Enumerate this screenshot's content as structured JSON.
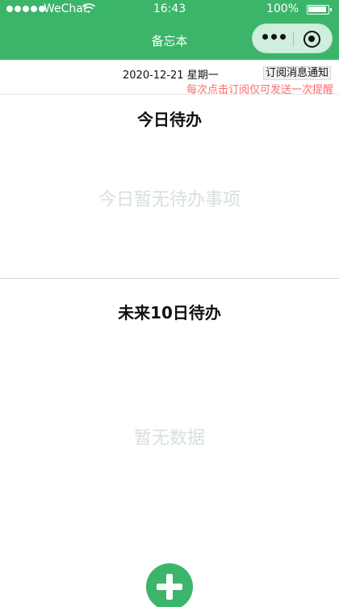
{
  "status_bar": {
    "carrier": "WeChat",
    "time": "16:43",
    "battery_percent": "100%",
    "wifi_icon": "wifi-icon",
    "signal_icon": "signal-dots-icon"
  },
  "nav": {
    "title": "备忘本",
    "more_icon": "more-dots-icon",
    "close_icon": "target-icon"
  },
  "date_row": {
    "date": "2020-12-21",
    "weekday": "星期一",
    "subscribe_label": "订阅消息通知",
    "hint": "每次点击订阅仅可发送一次提醒"
  },
  "today": {
    "title": "今日待办",
    "empty_text": "今日暂无待办事项"
  },
  "future": {
    "title": "未来10日待办",
    "empty_text": "暂无数据"
  },
  "add_button": {
    "icon": "plus-icon"
  },
  "colors": {
    "brand_green": "#3bb56a",
    "hint_red": "#ff6b6b",
    "empty_text_gray": "#d7dede"
  }
}
